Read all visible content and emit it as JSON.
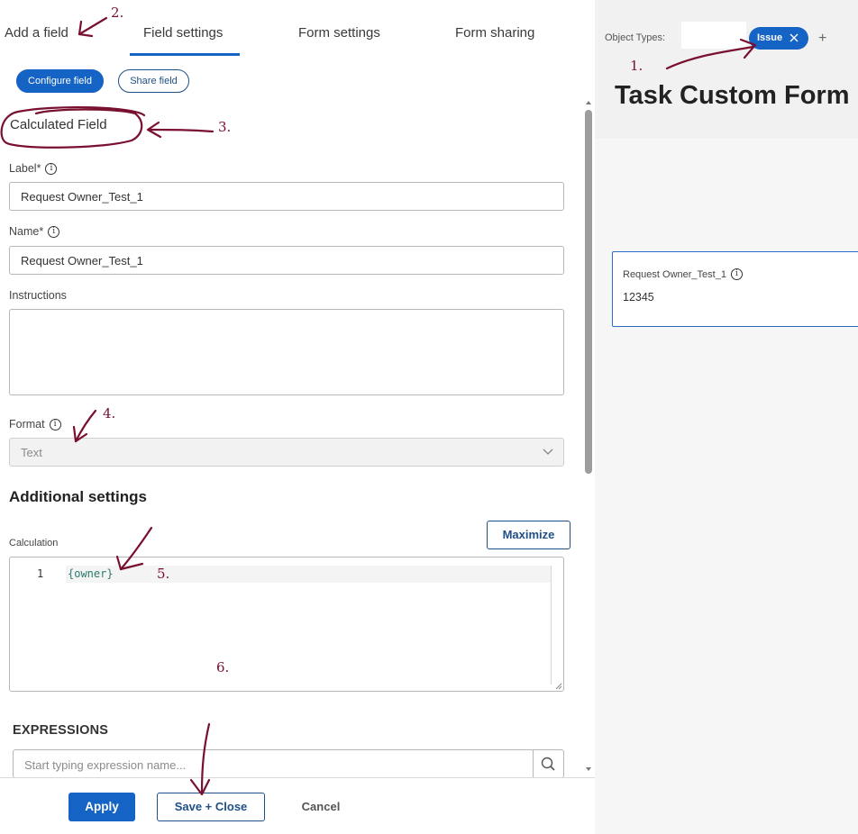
{
  "tabs": [
    {
      "label": "Add a field"
    },
    {
      "label": "Field settings"
    },
    {
      "label": "Form settings"
    },
    {
      "label": "Form sharing"
    }
  ],
  "pills": {
    "configure": "Configure field",
    "share": "Share field"
  },
  "section_title": "Calculated Field",
  "fields": {
    "label": {
      "label": "Label*",
      "value": "Request Owner_Test_1"
    },
    "name": {
      "label": "Name*",
      "value": "Request Owner_Test_1"
    },
    "instructions": {
      "label": "Instructions",
      "value": ""
    },
    "format": {
      "label": "Format",
      "value": "Text"
    }
  },
  "additional_settings": "Additional settings",
  "calculation": {
    "label": "Calculation",
    "maximize": "Maximize",
    "line_number": "1",
    "code": "{owner}"
  },
  "expressions": {
    "title": "EXPRESSIONS",
    "placeholder": "Start typing expression name..."
  },
  "footer": {
    "apply": "Apply",
    "save_close": "Save + Close",
    "cancel": "Cancel"
  },
  "right_panel": {
    "object_types_label": "Object Types:",
    "chip": "Issue",
    "plus": "+",
    "form_title": "Task Custom Form",
    "preview_field_label": "Request Owner_Test_1",
    "preview_field_value": "12345"
  },
  "annotations": [
    "1.",
    "2.",
    "3.",
    "4.",
    "5.",
    "6."
  ],
  "colors": {
    "accent": "#1563c4",
    "annotation": "#7a1030"
  }
}
